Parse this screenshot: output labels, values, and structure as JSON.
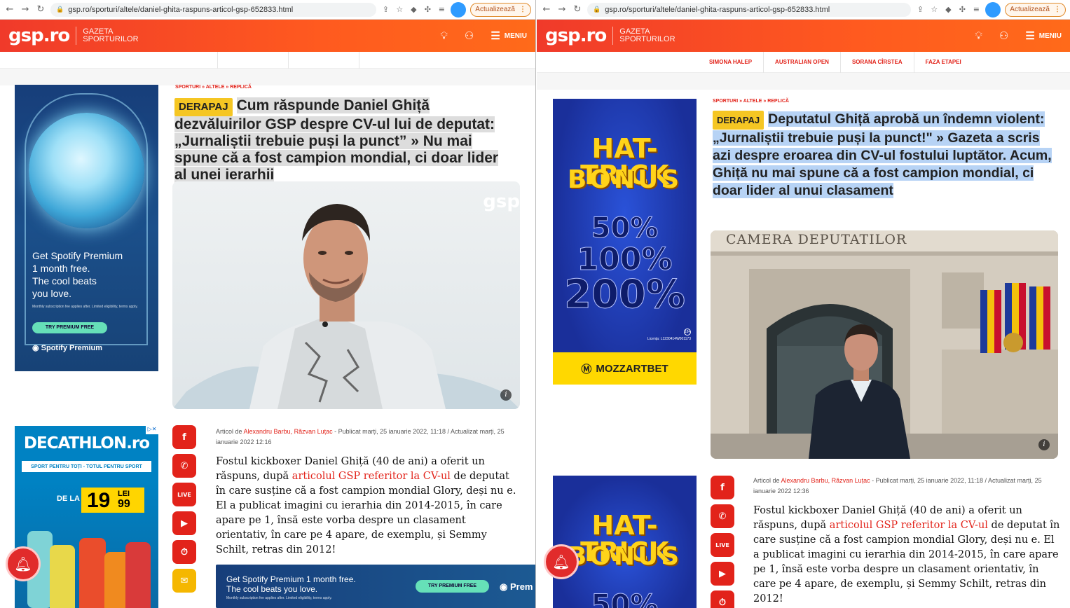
{
  "browser": {
    "url": "gsp.ro/sporturi/altele/daniel-ghita-raspuns-articol-gsp-652833.html",
    "update_label": "Actualizează"
  },
  "site": {
    "logo": "gsp.ro",
    "tagline_line1": "GAZETA",
    "tagline_line2": "SPORTURILOR",
    "menu_label": "MENIU",
    "accent": "#e2231a",
    "subnav": [
      "SIMONA HALEP",
      "AUSTRALIAN OPEN",
      "SORANA CÎRSTEA",
      "FAZA ETAPEI"
    ]
  },
  "breadcrumb": [
    "SPORTURI",
    "ALTELE",
    "REPLICĂ"
  ],
  "tag": "DERAPAJ",
  "left": {
    "headline": "Cum răspunde Daniel Ghiță dezvăluirilor GSP despre CV-ul lui de deputat: „Jurnaliștii trebuie puși la punct” » Nu mai spune că a fost campion mondial, ci doar lider al unei ierarhii",
    "photo_watermark": "gsp",
    "meta_prefix": "Articol de ",
    "authors": "Alexandru Barbu, Răzvan Luțac",
    "meta_rest": " - Publicat marți, 25 ianuarie 2022, 11:18 / Actualizat marți, 25 ianuarie 2022 12:16",
    "body_before": "Fostul kickboxer Daniel Ghiță (40 de ani) a oferit un răspuns, după ",
    "body_link": "articolul GSP referitor la CV-ul",
    "body_after": " de deputat în care susține că a fost campion mondial Glory, deși nu e. El a publicat imagini cu ierarhia din 2014-2015, în care apare pe 1, însă este vorba despre un clasament orientativ, în care pe 4 apare, de exemplu, și Semmy Schilt, retras din 2012!"
  },
  "right": {
    "headline": "Deputatul Ghiță aprobă un îndemn violent: „Jurnaliștii trebuie puși la punct!\" » Gazeta a scris azi despre eroarea din CV-ul fostului luptător. Acum, Ghiță nu mai spune că a fost campion mondial, ci doar lider al unui clasament",
    "photo_sign": "CAMERA DEPUTATILOR",
    "meta_prefix": "Articol de ",
    "authors": "Alexandru Barbu, Răzvan Luțac",
    "meta_rest": " - Publicat marți, 25 ianuarie 2022, 11:18 / Actualizat marți, 25 ianuarie 2022 12:36",
    "body_before": "Fostul kickboxer Daniel Ghiță (40 de ani) a oferit un răspuns, după ",
    "body_link": "articolul GSP referitor la CV-ul",
    "body_after": " de deputat în care susține că a fost campion mondial Glory, deși nu e. El a publicat imagini cu ierarhia din 2014-2015, în care apare pe 1, însă este vorba despre un clasament orientativ, în care pe 4 apare, de exemplu, și Semmy Schilt, retras din 2012!"
  },
  "ads": {
    "spotify": {
      "line1": "Get Spotify Premium",
      "line2": "1 month free.",
      "line3": "The cool beats",
      "line4": "you love.",
      "fine": "Monthly subscription fee applies after. Limited eligibility, terms apply.",
      "cta": "TRY PREMIUM FREE",
      "brand": "Spotify Premium"
    },
    "spotify_wide": {
      "line1": "Get Spotify Premium 1 month free.",
      "line2": "The cool beats you love.",
      "fine": "Monthly subscription fee applies after. Limited eligibility, terms apply.",
      "cta": "TRY PREMIUM FREE",
      "brand": "Prem"
    },
    "decathlon": {
      "logo": "DECATHLON.ro",
      "slogan": "SPORT PENTRU TOȚI - TOTUL PENTRU SPORT",
      "from": "DE LA",
      "price_int": "19",
      "price_cur": "LEI",
      "price_dec": "99"
    },
    "mozzart": {
      "title1": "HAT-TRICK",
      "title2": "BONUS",
      "p1": "50%",
      "p2": "100%",
      "p3": "200%",
      "license": "Licența: L1230414W001173",
      "brand": "MOZZARTBET",
      "age": "18+"
    }
  },
  "social": [
    "f",
    "w",
    "LIVE",
    "▶",
    "⏱",
    "💬"
  ]
}
